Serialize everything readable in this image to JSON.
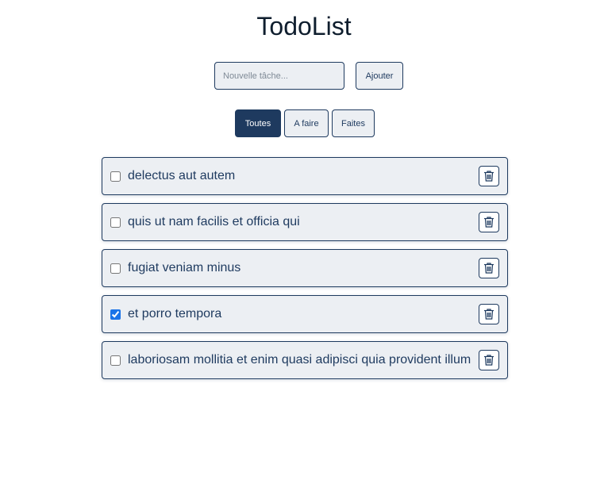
{
  "app": {
    "title": "TodoList"
  },
  "add_form": {
    "input_value": "",
    "input_placeholder": "Nouvelle tâche...",
    "add_label": "Ajouter"
  },
  "filters": [
    {
      "label": "Toutes",
      "active": true
    },
    {
      "label": "A faire",
      "active": false
    },
    {
      "label": "Faites",
      "active": false
    }
  ],
  "todos": [
    {
      "text": "delectus aut autem",
      "done": false
    },
    {
      "text": "quis ut nam facilis et officia qui",
      "done": false
    },
    {
      "text": "fugiat veniam minus",
      "done": false
    },
    {
      "text": "et porro tempora",
      "done": true
    },
    {
      "text": "laboriosam mollitia et enim quasi adipisci quia provident illum",
      "done": false
    }
  ],
  "icons": {
    "delete": "trash-icon"
  },
  "colors": {
    "primary": "#1e3a5f",
    "item_background": "#eceff3",
    "checkbox_accent": "#1a73e8"
  }
}
